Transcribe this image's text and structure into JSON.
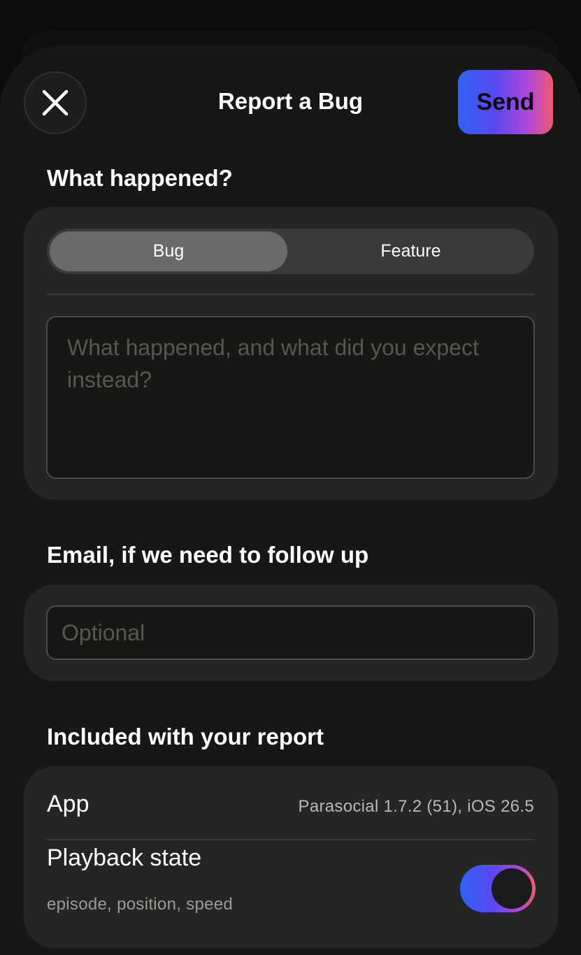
{
  "header": {
    "title": "Report a Bug",
    "send_label": "Send",
    "close_icon": "close-icon"
  },
  "what_happened": {
    "heading": "What happened?",
    "segments": [
      "Bug",
      "Feature"
    ],
    "selected_segment": "Bug",
    "description_placeholder": "What happened, and what did you expect instead?",
    "description_value": ""
  },
  "email": {
    "heading": "Email, if we need to follow up",
    "placeholder": "Optional",
    "value": ""
  },
  "included": {
    "heading": "Included with your report",
    "rows": [
      {
        "label": "App",
        "value": "Parasocial 1.7.2 (51), iOS 26.5"
      },
      {
        "label": "Playback state",
        "sublabel": "episode, position, speed",
        "toggle_on": true
      }
    ]
  },
  "colors": {
    "accent_gradient": [
      "#2f63f5",
      "#5b47f0",
      "#b447d8",
      "#f05a6e"
    ],
    "background": "#171816",
    "card": "#252624"
  }
}
